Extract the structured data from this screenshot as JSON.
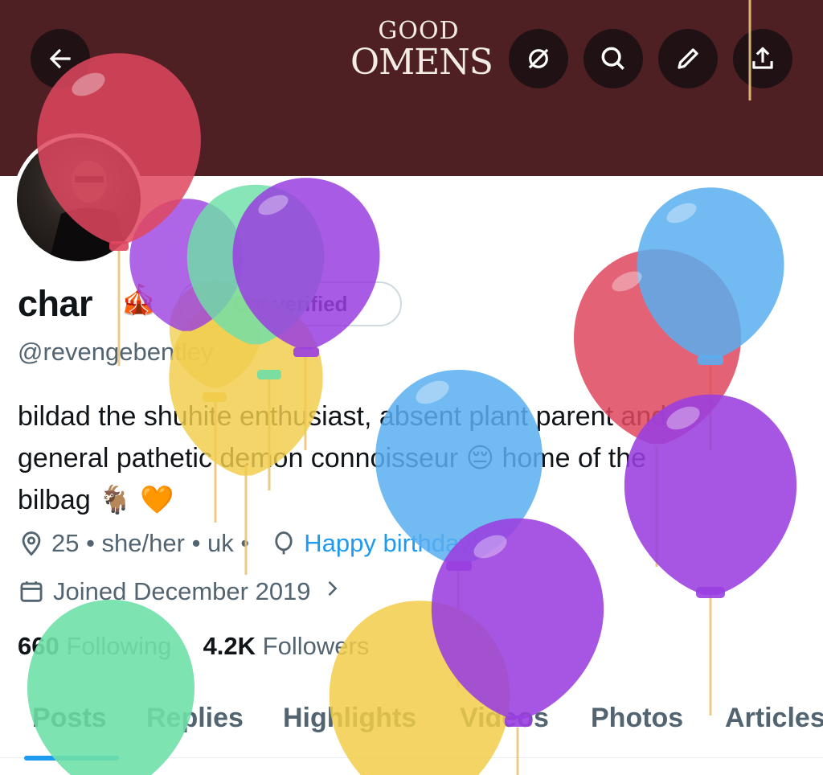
{
  "header": {
    "logo_line1": "GOOD",
    "logo_line2": "OMENS",
    "back_icon": "arrow-left-icon",
    "buttons": [
      "unmute-icon",
      "search-icon",
      "edit-icon",
      "share-icon"
    ]
  },
  "profile": {
    "name": "char",
    "name_emoji": "🎪",
    "verify_label": "Get verified",
    "handle": "@revengebentley",
    "bio_line1": "bildad the shuhite enthusiast, absent plant parent and",
    "bio_line2": "general pathetic demon connoisseur 😔 home of the",
    "bio_line3": "bilbag 🐐 🧡",
    "meta_text": "25 • she/her • uk •",
    "birthday_link": "Happy birthday!",
    "joined": "Joined December 2019",
    "following_count": "660",
    "following_label": "Following",
    "followers_count": "4.2K",
    "followers_label": "Followers"
  },
  "tabs": [
    {
      "label": "Posts"
    },
    {
      "label": "Replies"
    },
    {
      "label": "Highlights"
    },
    {
      "label": "Videos"
    },
    {
      "label": "Photos"
    },
    {
      "label": "Articles"
    }
  ],
  "colors": {
    "banner": "#4f2023",
    "accent": "#1d9bf0",
    "balloon_red": "#e0475f",
    "balloon_purple": "#9a3fe0",
    "balloon_green": "#6fe0a8",
    "balloon_yellow": "#f1cd4a",
    "balloon_blue": "#5aaef0"
  }
}
